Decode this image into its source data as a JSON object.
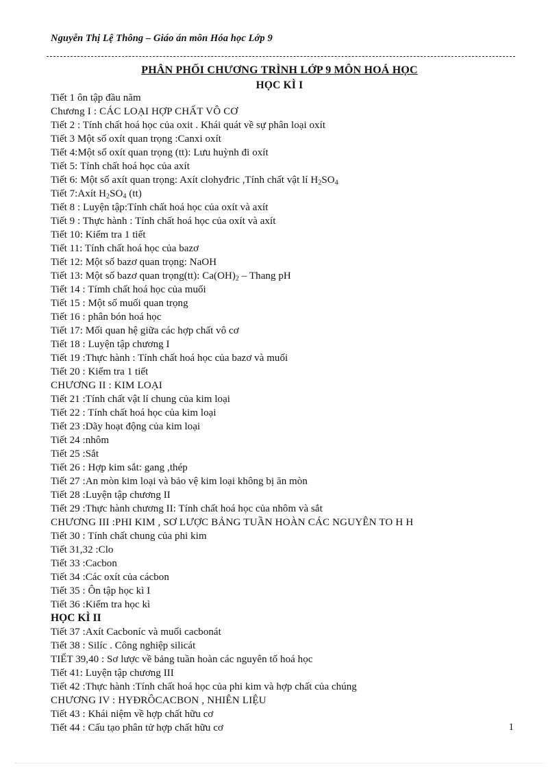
{
  "header": {
    "running_head": "Nguyễn Thị Lệ Thông – Giáo án môn Hóa học Lớp 9"
  },
  "title": {
    "main": "PHÂN PHỐI CHƯƠNG TRÌNH LỚP 9 MÔN HOÁ HỌC",
    "sub": "HỌC KÌ I"
  },
  "footer": {
    "page_number": "1"
  },
  "body": {
    "lines": [
      {
        "kind": "lesson",
        "text": "Tiết 1 ôn tập đầu năm"
      },
      {
        "kind": "chapter",
        "text": "Chương I : CÁC LOẠI HỢP CHẤT VÔ CƠ"
      },
      {
        "kind": "lesson",
        "text": "Tiết 2 : Tính  chất hoá học của oxit . Khái quát về sự phân loại  oxít"
      },
      {
        "kind": "lesson",
        "text": "Tiết 3 Một số oxít  quan trọng :Canxi  oxít"
      },
      {
        "kind": "lesson",
        "text": "Tiết 4:Một số oxít  quan trọng (tt): Lưu huỳnh  đi oxít"
      },
      {
        "kind": "lesson",
        "text": "Tiết 5: Tính  chất hoá học của axít"
      },
      {
        "kind": "formula",
        "prefix": "Tiết 6: Một số axít  quan trọng:  Axít  clohyđric  ,Tính  chất vật lí ",
        "formula": [
          {
            "t": "H"
          },
          {
            "t": "2",
            "sub": true
          },
          {
            "t": "SO"
          },
          {
            "t": "4",
            "sub": true
          }
        ],
        "suffix": ""
      },
      {
        "kind": "formula",
        "prefix": "Tiết 7:Axít  ",
        "formula": [
          {
            "t": "H"
          },
          {
            "t": "2",
            "sub": true
          },
          {
            "t": "SO"
          },
          {
            "t": "4",
            "sub": true
          }
        ],
        "suffix": " (tt)"
      },
      {
        "kind": "lesson",
        "text": "Tiết 8 : Luyện  tập:Tính  chất hoá học của oxít và axít"
      },
      {
        "kind": "lesson",
        "text": "Tiết 9 : Thực  hành : Tính  chất hoá học của oxít và axít"
      },
      {
        "kind": "lesson",
        "text": "Tiết 10: Kiểm  tra 1 tiết"
      },
      {
        "kind": "lesson",
        "text": "Tiết 11: Tính  chất hoá học của bazơ"
      },
      {
        "kind": "lesson",
        "text": "Tiết 12: Một số bazơ quan trọng:  NaOH"
      },
      {
        "kind": "formula",
        "prefix": "Tiết 13: Một số bazơ quan trọng(tt):  Ca(OH)",
        "formula": [
          {
            "t": "2",
            "sub": true
          }
        ],
        "suffix": " – Thang  pH"
      },
      {
        "kind": "lesson",
        "text": "Tiết 14 : Tímh  chất hoá học của muối"
      },
      {
        "kind": "lesson",
        "text": "Tiết 15 : Một số muối  quan trọng"
      },
      {
        "kind": "lesson",
        "text": "Tiết 16 : phân bón hoá học"
      },
      {
        "kind": "lesson",
        "text": "Tiết 17: Mối quan hệ giữa các hợp chất vô cơ"
      },
      {
        "kind": "lesson",
        "text": "Tiết 18 : Luyện  tập chương I"
      },
      {
        "kind": "lesson",
        "text": "Tiết 19 :Thực  hành : Tính  chất hoá học của bazơ và muối"
      },
      {
        "kind": "lesson",
        "text": "Tiết 20 : Kiểm  tra 1 tiết"
      },
      {
        "kind": "chapter",
        "text": "CHƯƠNG II : KIM LOẠI"
      },
      {
        "kind": "lesson",
        "text": "Tiết 21 :Tính  chất vật lí chung  của kim  loại"
      },
      {
        "kind": "lesson",
        "text": "Tiết 22 : Tính  chất hoá học của kim  loại"
      },
      {
        "kind": "lesson",
        "text": "Tiết 23 :Dãy hoạt động của kim  loại"
      },
      {
        "kind": "lesson",
        "text": "Tiết 24 :nhôm"
      },
      {
        "kind": "lesson",
        "text": "Tiết 25 :Sắt"
      },
      {
        "kind": "lesson",
        "text": "Tiết 26 : Hợp kim  sắt: gang  ,thép"
      },
      {
        "kind": "lesson",
        "text": "Tiết 27 :An  mòn kim  loại và bảo vệ kim  loại không  bị ăn mòn"
      },
      {
        "kind": "lesson",
        "text": "Tiết 28 :Luyện   tập chương  II"
      },
      {
        "kind": "lesson",
        "text": "Tiết 29 :Thực  hành  chương  II: Tính  chất hoá học của nhôm  và sắt"
      },
      {
        "kind": "chapter",
        "text": "CHƯƠNG III :PHI KIM , SƠ LƯỢC BẢNG TUẦN HOÀN CÁC NGUYÊN TO H H"
      },
      {
        "kind": "lesson",
        "text": "Tiết 30 : Tính  chất chung  của phi kim"
      },
      {
        "kind": "lesson",
        "text": "Tiết 31,32 :Clo"
      },
      {
        "kind": "lesson",
        "text": "Tiết 33 :Cacbon"
      },
      {
        "kind": "lesson",
        "text": "Tiết 34 :Các oxít của cácbon"
      },
      {
        "kind": "lesson",
        "text": "Tiết 35 : Ôn tập học kì I"
      },
      {
        "kind": "lesson",
        "text": "Tiết 36 :Kiểm  tra học kì"
      },
      {
        "kind": "semester",
        "text": "HỌC KÌ II"
      },
      {
        "kind": "lesson",
        "text": "Tiết 37 :Axít  Cacboníc  và muối  cacbonát"
      },
      {
        "kind": "lesson",
        "text": "Tiết 38 : Silíc  . Công nghiệp  silicát"
      },
      {
        "kind": "lesson",
        "text": "TIẾT 39,40 : Sơ lược về bảng tuần  hoàn các nguyên  tố hoá học"
      },
      {
        "kind": "lesson",
        "text": "Tiết 41: Luyện  tập chương  III"
      },
      {
        "kind": "lesson",
        "text": "Tiết 42 :Thực  hành :Tính  chất hoá học của phi kim  và hợp chất của chúng"
      },
      {
        "kind": "chapter",
        "text": "CHƯƠNG IV : HYĐRÔCACBON , NHIÊN LIỆU"
      },
      {
        "kind": "lesson",
        "text": "Tiết 43 : Khái niệm  về hợp chất hữu cơ"
      },
      {
        "kind": "lesson",
        "text": "Tiết 44 : Cấu tạo phân tử hợp chất hữu cơ"
      }
    ]
  }
}
